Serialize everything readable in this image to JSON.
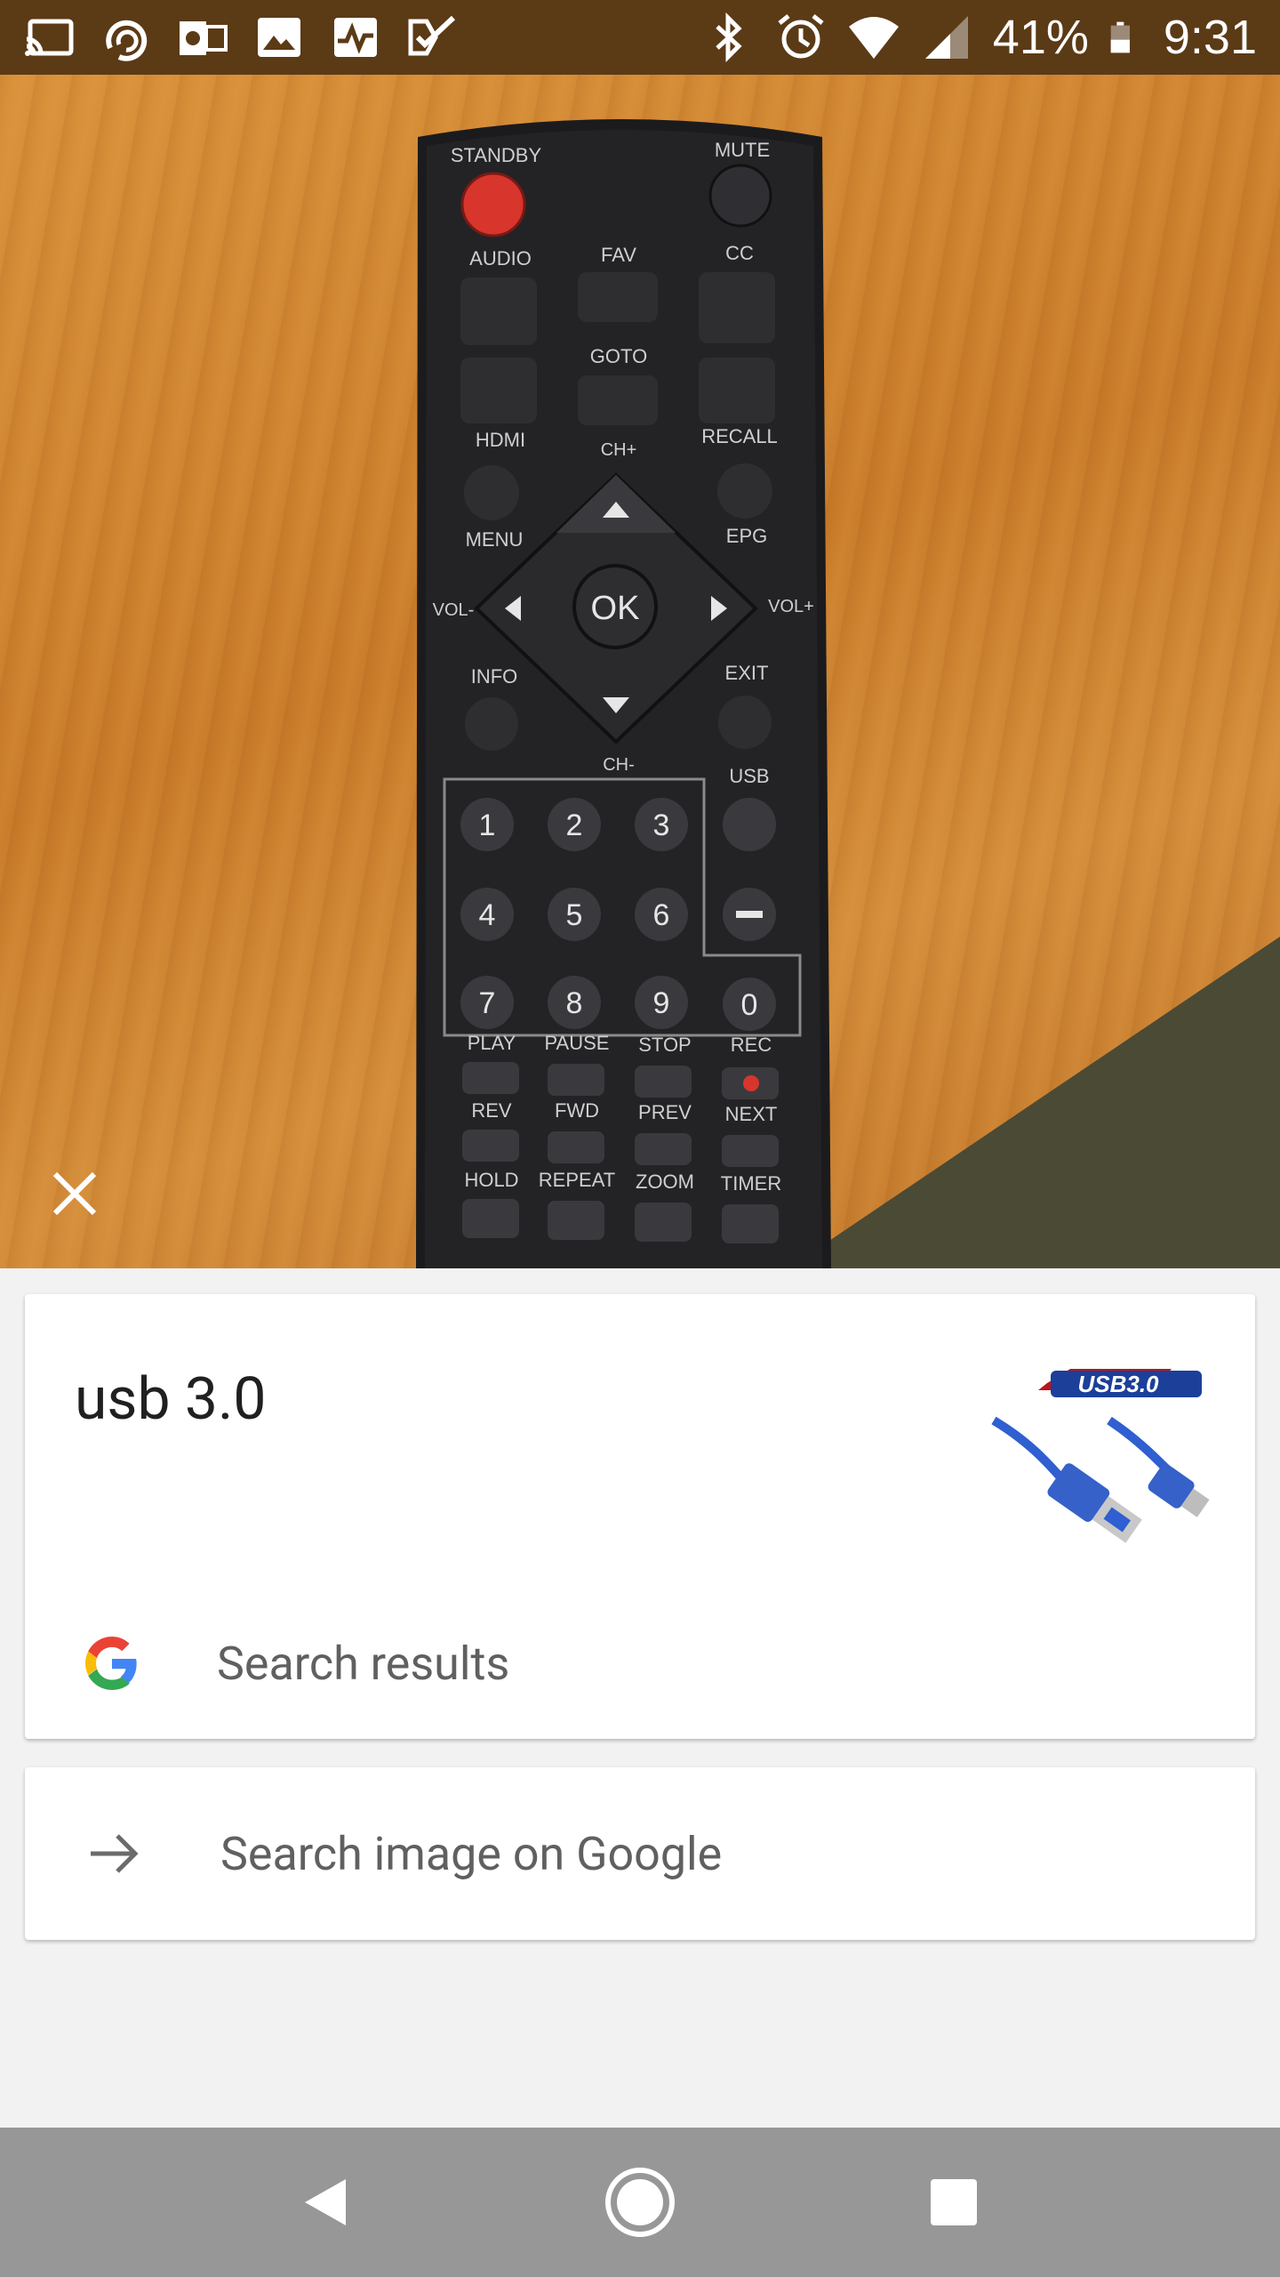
{
  "status_bar": {
    "battery": "41%",
    "time": "9:31",
    "left_icons": [
      "cast-icon",
      "ring-app-icon",
      "outlook-icon",
      "gallery-icon",
      "activity-icon",
      "tasks-icon"
    ],
    "right_icons": [
      "bluetooth-icon",
      "alarm-icon",
      "wifi-icon",
      "signal-icon",
      "battery-icon"
    ]
  },
  "photo": {
    "subject": "remote-control",
    "remote": {
      "top_labels": [
        "STANDBY",
        "MUTE"
      ],
      "row_labels": [
        "AUDIO",
        "FAV",
        "CC",
        "GOTO",
        "HDMI",
        "CH+",
        "RECALL",
        "MENU",
        "EPG",
        "VOL-",
        "OK",
        "VOL+",
        "INFO",
        "EXIT",
        "CH-",
        "USB"
      ],
      "numbers": [
        "1",
        "2",
        "3",
        "4",
        "5",
        "6",
        "7",
        "8",
        "9",
        "0"
      ],
      "media_labels_1": [
        "PLAY",
        "PAUSE",
        "STOP",
        "REC"
      ],
      "media_labels_2": [
        "REV",
        "FWD",
        "PREV",
        "NEXT"
      ],
      "media_labels_3": [
        "HOLD",
        "REPEAT",
        "ZOOM",
        "TIMER"
      ]
    }
  },
  "result_card": {
    "title": "usb 3.0",
    "thumbnail_text": "USB3.0",
    "search_results_label": "Search results"
  },
  "search_card": {
    "label": "Search image on Google"
  },
  "nav": {
    "back": "back-icon",
    "home": "home-icon",
    "recents": "recents-icon"
  },
  "colors": {
    "status_bar_bg": "#5b3a16",
    "nav_bar_bg": "#979797",
    "page_bg": "#f2f2f2",
    "google_blue": "#4285F4",
    "google_red": "#EA4335",
    "google_yellow": "#FBBC05",
    "google_green": "#34A853"
  }
}
